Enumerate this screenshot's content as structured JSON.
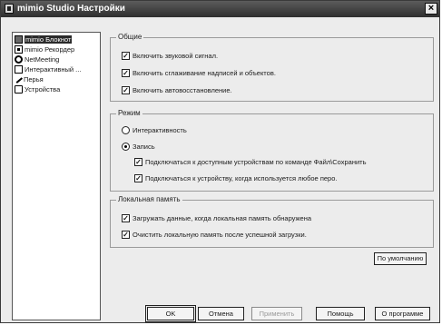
{
  "window": {
    "title": "mimio Studio Настройки",
    "close_label": "×"
  },
  "sidebar": {
    "items": [
      {
        "label": "mimio Блокнот",
        "icon": "notebook-icon",
        "selected": true
      },
      {
        "label": "mimio Рекордер",
        "icon": "recorder-icon",
        "selected": false
      },
      {
        "label": "NetMeeting",
        "icon": "netmeeting-icon",
        "selected": false
      },
      {
        "label": "Интерактивный ...",
        "icon": "interactive-icon",
        "selected": false
      },
      {
        "label": "Перья",
        "icon": "pen-icon",
        "selected": false
      },
      {
        "label": "Устройства",
        "icon": "devices-icon",
        "selected": false
      }
    ]
  },
  "general": {
    "legend": "Общие",
    "options": [
      {
        "label": "Включить звуковой сигнал.",
        "checked": true
      },
      {
        "label": "Включить сглаживание надписей и объектов.",
        "checked": true
      },
      {
        "label": "Включить автовосстановление.",
        "checked": true
      }
    ]
  },
  "mode": {
    "legend": "Режим",
    "interactive_label": "Интерактивность",
    "record_label": "Запись",
    "selected": "record",
    "sub_options": [
      {
        "label": "Подключаться к доступным устройствам по команде Файл\\Сохранить",
        "checked": true
      },
      {
        "label": "Подключаться к устройству, когда используется любое перо.",
        "checked": true
      }
    ]
  },
  "local_memory": {
    "legend": "Локальная память",
    "options": [
      {
        "label": "Загружать данные, когда локальная память обнаружена",
        "checked": true
      },
      {
        "label": "Очистить локальную память после успешной загрузки.",
        "checked": true
      }
    ]
  },
  "buttons": {
    "defaults": "По умолчанию",
    "ok": "OK",
    "cancel": "Отмена",
    "apply": "Применить",
    "help": "Помощь",
    "about": "О программе"
  },
  "check_glyph": "✓"
}
